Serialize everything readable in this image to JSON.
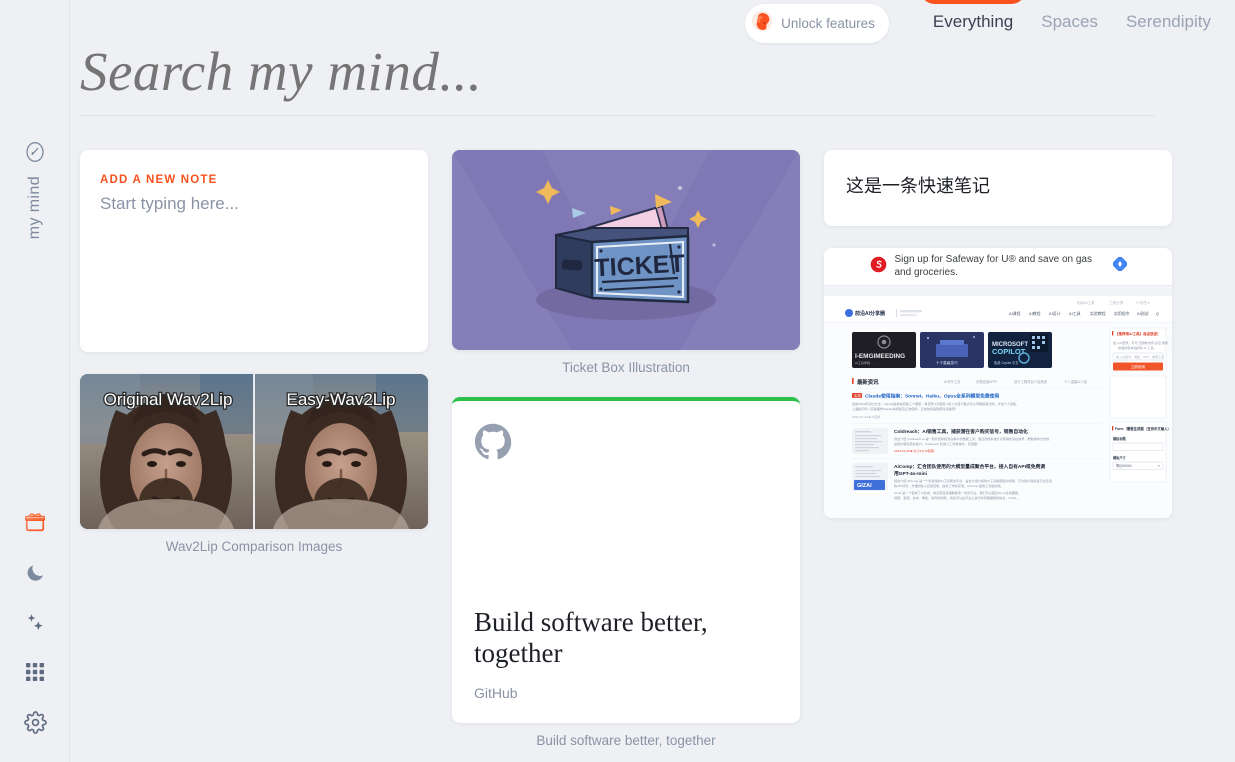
{
  "app": {
    "brand_name": "my mind",
    "brand_logo_icon": "mind-circle-icon",
    "background_color": "#eef0f4",
    "accent_color": "#f9521e"
  },
  "sidebar": {
    "bottom_items": [
      {
        "label": "Gifts",
        "icon": "gift-icon",
        "color": "#f9521e"
      },
      {
        "label": "Dark mode",
        "icon": "moon-icon",
        "color": "#7e8a9e"
      },
      {
        "label": "Magic",
        "icon": "sparkles-icon",
        "color": "#7e8a9e"
      },
      {
        "label": "Apps",
        "icon": "grid-icon",
        "color": "#7e8a9e"
      },
      {
        "label": "Settings",
        "icon": "gear-icon",
        "color": "#7e8a9e"
      }
    ]
  },
  "topnav": {
    "unlock_label": "Unlock features",
    "unlock_icon": "brain-icon",
    "tabs": [
      {
        "label": "Everything",
        "active": true
      },
      {
        "label": "Spaces",
        "active": false
      },
      {
        "label": "Serendipity",
        "active": false
      }
    ]
  },
  "search": {
    "placeholder": "Search my mind...",
    "value": ""
  },
  "cards": {
    "new_note": {
      "label": "ADD A NEW NOTE",
      "placeholder": "Start typing here..."
    },
    "wav2lip": {
      "caption": "Wav2Lip Comparison Images",
      "left_label": "Original Wav2Lip",
      "right_label": "Easy-Wav2Lip"
    },
    "ticket": {
      "caption": "Ticket Box Illustration",
      "art_text": "TICKET",
      "background_color": "#8078b4"
    },
    "github": {
      "caption": "Build software better, together",
      "title": "Build software better, together",
      "source": "GitHub",
      "icon": "github-icon",
      "accent_color": "#2dc14a"
    },
    "quick_note_zh": {
      "text": "这是一条快速笔记"
    },
    "web_snapshot": {
      "ad_text": "Sign up for Safeway for U® and save on gas and groceries.",
      "ad_icon": "safeway-icon",
      "ad_choices_icon": "adchoices-icon",
      "site_name": "前沿AI分享圈",
      "nav_links": [
        "AI课程",
        "AI教程",
        "AI设计",
        "AI工具",
        "实验教程",
        "实用指令",
        "AI测试",
        "Q"
      ],
      "top_links": [
        "相似AI工具",
        "工具分类",
        "小东西 ▾"
      ],
      "tiles": [
        "I-EMGIMEEDING",
        "十个高级技巧",
        "MICROSOFT COPILOT"
      ],
      "section_title": "最新资讯",
      "section_links": [
        "AI写作工具",
        "长尾应用APP+",
        "设计工程项目介绍系统",
        "个人温馨AI介绍"
      ],
      "articles": [
        {
          "badge": "实测",
          "title": "Claude使用指南：Sonnet、Haiku、Opus全系列模型免费使用",
          "body": "最新2024年对比方法：Claude提供免费版三个模型，每日限 3次使用 1篇入为显不能大及公司模版官方网，方法个人百私、上面指示例（实验理学Claude免费版及正常使用、正常免费提款部对话说明）"
        },
        {
          "title": "Coldreach：AI销售工具，捕获潜在客户购买信号，销售自动化",
          "body": "综合介绍 Coldreach.ai 是一款外贸易和潜在客户的数据工具，通过智能系统针对营销的潜在信号，帮助操作方式的最终内容到潜在客户。Coldreach 利用人工智能技术，实现跟...",
          "meta": "2024-10-25  大小2.8  AI营销"
        },
        {
          "title": "AiComp：汇合团队使用的大模型量成聚合平台，接入自有API或免费调用GPT-4o-mini",
          "body": "综合介绍 AiComp 是一个综合性的AI工具聚合平台，旨在为用户提供AI工具和模型的调用，可为用户提供多元化及自的API访问，方便的私人应用自例、提供工作的实现。AiComp 提供工具新的线。",
          "logo": "GIZAI"
        }
      ],
      "sidebar_box_title": "【推荐用AI工具】自由放送！",
      "sidebar_box_body": "加入AI登录，可可 无限制访问 必应 搜索、快速找到本站所有 AI 工具。",
      "sidebar_input_placeholder": "输入关键词，例如：GPT、教研工具",
      "sidebar_button": "立即使用",
      "form_title": "Form（需要生成器（支持中文输入）",
      "form_field1_label": "模板标题",
      "form_field2_label": "模板尺寸",
      "form_field2_value": "等比60X60"
    }
  }
}
